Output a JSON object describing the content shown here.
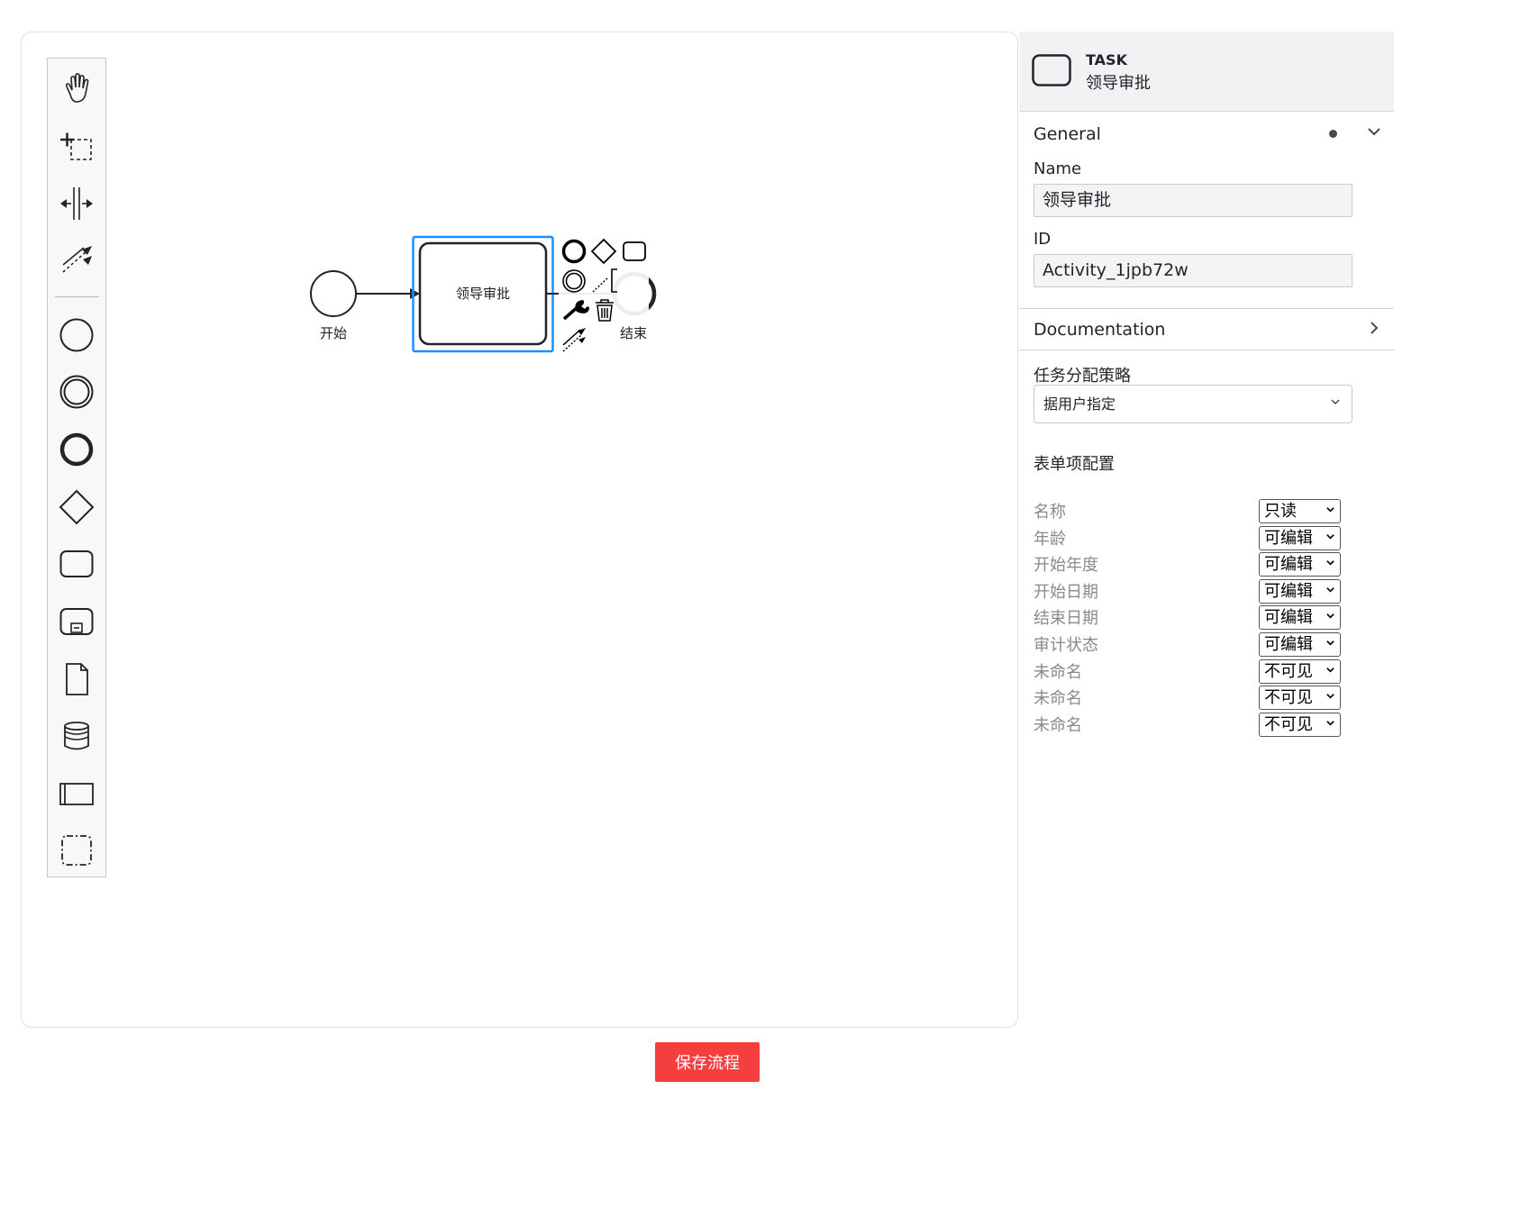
{
  "palette": {
    "tools": [
      {
        "icon": "hand-tool-icon"
      },
      {
        "icon": "lasso-tool-icon"
      },
      {
        "icon": "space-tool-icon"
      },
      {
        "icon": "global-connect-tool-icon"
      },
      {
        "icon": "start-event-icon"
      },
      {
        "icon": "intermediate-event-icon"
      },
      {
        "icon": "end-event-icon"
      },
      {
        "icon": "gateway-icon"
      },
      {
        "icon": "task-icon"
      },
      {
        "icon": "subprocess-icon"
      },
      {
        "icon": "data-object-icon"
      },
      {
        "icon": "data-store-icon"
      },
      {
        "icon": "pool-icon"
      },
      {
        "icon": "group-icon"
      }
    ]
  },
  "diagram": {
    "start_label": "开始",
    "task_label": "领导审批",
    "end_label": "结束",
    "selection_color": "#1890ff"
  },
  "properties": {
    "header": {
      "type": "TASK",
      "name": "领导审批"
    },
    "general": {
      "title": "General",
      "name_label": "Name",
      "name_value": "领导审批",
      "id_label": "ID",
      "id_value": "Activity_1jpb72w"
    },
    "documentation": {
      "title": "Documentation"
    },
    "strategy": {
      "label": "任务分配策略",
      "value": "据用户指定"
    },
    "form_config": {
      "title": "表单项配置",
      "rows": [
        {
          "label": "名称",
          "value": "只读"
        },
        {
          "label": "年龄",
          "value": "可编辑"
        },
        {
          "label": "开始年度",
          "value": "可编辑"
        },
        {
          "label": "开始日期",
          "value": "可编辑"
        },
        {
          "label": "结束日期",
          "value": "可编辑"
        },
        {
          "label": "审计状态",
          "value": "可编辑"
        },
        {
          "label": "未命名",
          "value": "不可见"
        },
        {
          "label": "未命名",
          "value": "不可见"
        },
        {
          "label": "未命名",
          "value": "不可见"
        }
      ]
    }
  },
  "actions": {
    "save_label": "保存流程",
    "save_color": "#f53f3f"
  }
}
